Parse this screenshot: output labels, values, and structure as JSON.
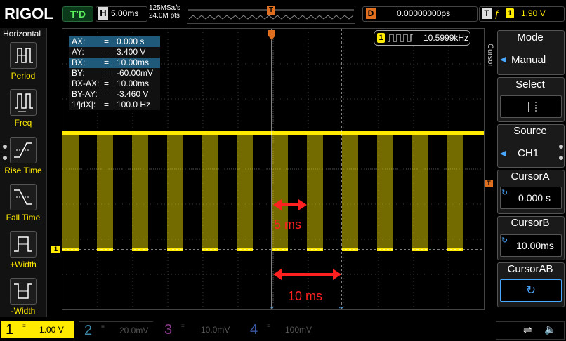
{
  "header": {
    "logo": "RIGOL",
    "run_mode": "T'D",
    "horizontal_letter": "H",
    "timebase": "5.00ms",
    "sample_rate": "125MSa/s",
    "memory_depth": "24.0M pts",
    "trigger_marker": "T",
    "delay_letter": "D",
    "delay_value": "0.00000000ps",
    "trigger_letter": "T",
    "trigger_channel": "1",
    "trigger_level": "1.90 V"
  },
  "left_menu": {
    "title": "Horizontal",
    "items": [
      {
        "label": "Period"
      },
      {
        "label": "Freq"
      },
      {
        "label": "Rise Time"
      },
      {
        "label": "Fall Time"
      },
      {
        "label": "+Width"
      },
      {
        "label": "-Width"
      }
    ]
  },
  "cursor_readout": {
    "rows": [
      {
        "key": "AX:",
        "eq": "=",
        "val": "0.000 s",
        "highlight": true
      },
      {
        "key": "AY:",
        "eq": "=",
        "val": "3.400 V",
        "highlight": false
      },
      {
        "key": "BX:",
        "eq": "=",
        "val": "10.00ms",
        "highlight": true
      },
      {
        "key": "BY:",
        "eq": "=",
        "val": "-60.00mV",
        "highlight": false
      },
      {
        "key": "BX-AX:",
        "eq": "=",
        "val": "10.00ms",
        "highlight": false
      },
      {
        "key": "BY-AY:",
        "eq": "=",
        "val": "-3.460 V",
        "highlight": false
      },
      {
        "key": "1/|dX|:",
        "eq": "=",
        "val": "100.0 Hz",
        "highlight": false
      }
    ]
  },
  "freq_counter": {
    "channel": "1",
    "value": "10.5999kHz"
  },
  "annotations": {
    "short": "5 ms",
    "long": "10 ms"
  },
  "markers": {
    "ch1": "1",
    "trig": "T"
  },
  "right_menu": {
    "side_label": "Cursor",
    "mode_title": "Mode",
    "mode_value": "Manual",
    "select_title": "Select",
    "source_title": "Source",
    "source_value": "CH1",
    "cursor_a_title": "CursorA",
    "cursor_a_value": "0.000 s",
    "cursor_b_title": "CursorB",
    "cursor_b_value": "10.00ms",
    "cursor_ab_title": "CursorAB"
  },
  "channels": [
    {
      "num": "1",
      "scale": "1.00 V",
      "color": "#ffea00"
    },
    {
      "num": "2",
      "scale": "20.0mV",
      "color": "#00c8ff"
    },
    {
      "num": "3",
      "scale": "10.0mV",
      "color": "#ff40ff"
    },
    {
      "num": "4",
      "scale": "100mV",
      "color": "#3a6cff"
    }
  ],
  "colors": {
    "ch1": "#ffea00",
    "trigger": "#e07020",
    "cursor_highlight": "#1f5a7a",
    "annotation": "#ff2020"
  }
}
